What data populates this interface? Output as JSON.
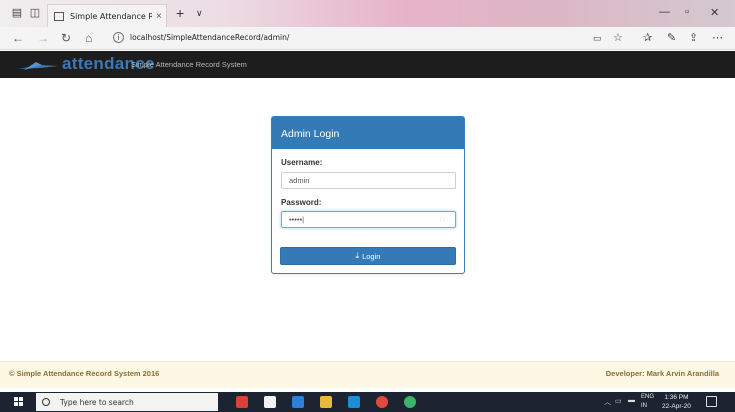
{
  "browser": {
    "tab_title": "Simple Attendance Reco",
    "tab_close": "×",
    "new_tab": "+",
    "url": "localhost/SimpleAttendanceRecord/admin/"
  },
  "navbar": {
    "brand": "attendance",
    "subtitle": "Simple Attendance Record System"
  },
  "login": {
    "heading": "Admin Login",
    "username_label": "Username:",
    "username_value": "admin",
    "password_label": "Password:",
    "password_value": "•••••|",
    "button_label": "Login"
  },
  "footer": {
    "left": "© Simple Attendance Record System 2016",
    "right": "Developer: Mark Arvin Arandilla"
  },
  "taskbar": {
    "search_placeholder": "Type here to search",
    "lang_line1": "ENG",
    "lang_line2": "IN",
    "time": "1:36 PM",
    "date": "22-Apr-20"
  },
  "colors": {
    "primary": "#337ab7",
    "navbar_bg": "#1d1d1d",
    "footer_bg": "#fcf8e3",
    "footer_text": "#8a6d3b"
  }
}
